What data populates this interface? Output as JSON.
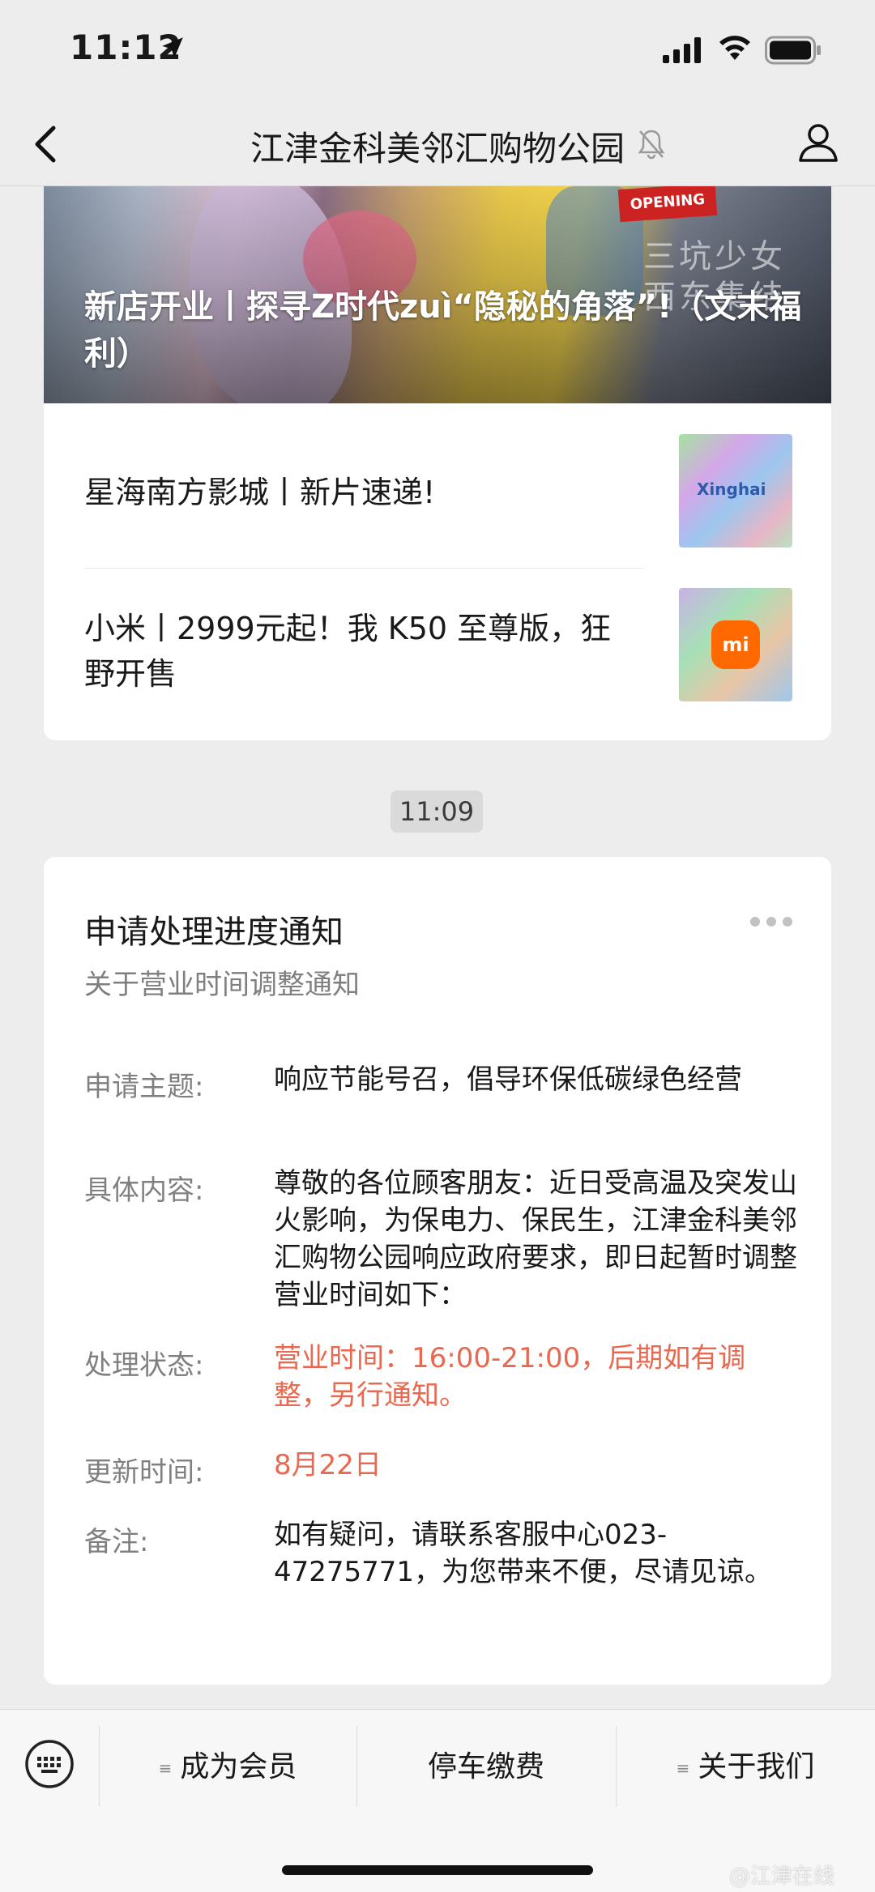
{
  "status_bar": {
    "time": "11:12"
  },
  "nav": {
    "title": "江津金科美邻汇购物公园"
  },
  "articles": {
    "cover_badge": "OPENING",
    "cover_deco": "三坑少女\n西东集结",
    "cover_title": "新店开业丨探寻Z时代zuì“隐秘的角落”!（文末福利）",
    "items": [
      {
        "title": "星海南方影城丨新片速递!",
        "thumb_text": "Xinghai"
      },
      {
        "title": "小米丨2999元起！我 K50 至尊版，狂野开售",
        "thumb_text": "mi"
      }
    ]
  },
  "timestamp": "11:09",
  "notice": {
    "title": "申请处理进度通知",
    "subtitle": "关于营业时间调整通知",
    "fields": [
      {
        "label": "申请主题:",
        "value": "响应节能号召，倡导环保低碳绿色经营"
      },
      {
        "label": "具体内容:",
        "value": "尊敬的各位顾客朋友：近日受高温及突发山火影响，为保电力、保民生，江津金科美邻汇购物公园响应政府要求，即日起暂时调整营业时间如下："
      },
      {
        "label": "处理状态:",
        "value": "营业时间：16:00-21:00，后期如有调整，另行通知。"
      },
      {
        "label": "更新时间:",
        "value": "8月22日"
      },
      {
        "label": "备注:",
        "value": "如有疑问，请联系客服中心023-47275771，为您带来不便，尽请见谅。"
      }
    ],
    "highlight_color": "#e9684f"
  },
  "menu": {
    "items": [
      {
        "label": "成为会员",
        "has_submenu": true
      },
      {
        "label": "停车缴费",
        "has_submenu": false
      },
      {
        "label": "关于我们",
        "has_submenu": true
      }
    ]
  },
  "watermark": "@江津在线"
}
